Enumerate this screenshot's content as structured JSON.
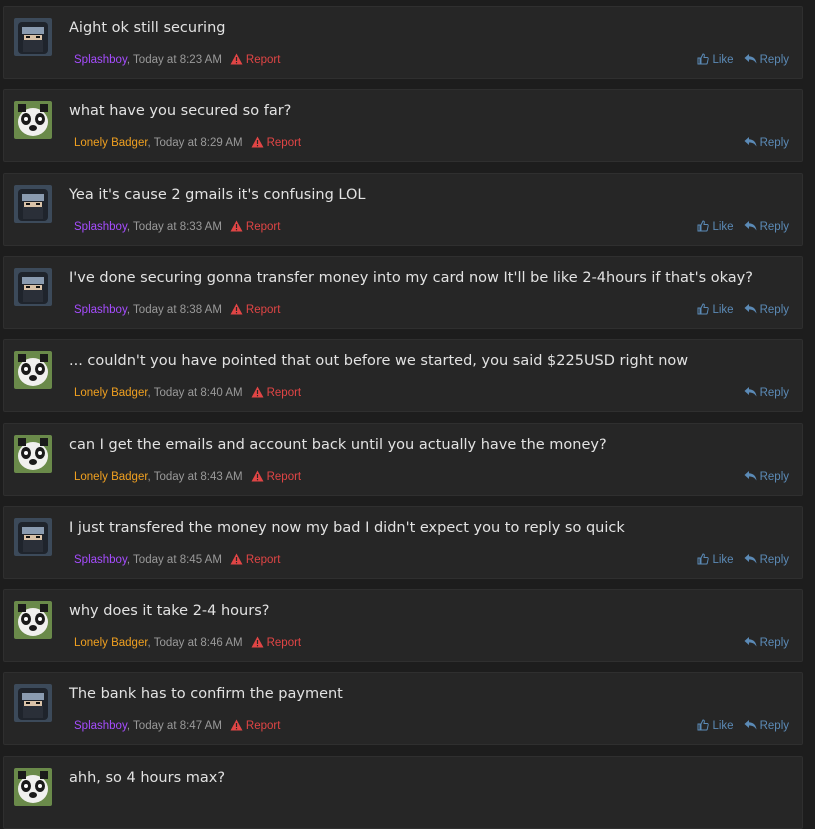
{
  "users": {
    "splashboy": {
      "name": "Splashboy",
      "color": "#a64dff"
    },
    "badger": {
      "name": "Lonely Badger",
      "color": "#f0a020"
    }
  },
  "labels": {
    "like": "Like",
    "reply": "Reply",
    "report": "Report"
  },
  "messages": [
    {
      "user": "splashboy",
      "text": "Aight ok still securing",
      "time": ", Today at 8:23 AM",
      "like": true
    },
    {
      "user": "badger",
      "text": "what have you secured so far?",
      "time": ", Today at 8:29 AM",
      "like": false
    },
    {
      "user": "splashboy",
      "text": "Yea it's cause 2 gmails it's confusing LOL",
      "time": ", Today at 8:33 AM",
      "like": true
    },
    {
      "user": "splashboy",
      "text": "I've done securing gonna transfer money into my card now It'll be like 2-4hours if that's okay?",
      "time": ", Today at 8:38 AM",
      "like": true
    },
    {
      "user": "badger",
      "text": "... couldn't you have pointed that out before we started, you said $225USD right now",
      "time": ", Today at 8:40 AM",
      "like": false
    },
    {
      "user": "badger",
      "text": "can I get the emails and account back until you actually have the money?",
      "time": ", Today at 8:43 AM",
      "like": false
    },
    {
      "user": "splashboy",
      "text": "I just transfered the money now my bad I didn't expect you to reply so quick",
      "time": ", Today at 8:45 AM",
      "like": true
    },
    {
      "user": "badger",
      "text": "why does it take 2-4 hours?",
      "time": ", Today at 8:46 AM",
      "like": false
    },
    {
      "user": "splashboy",
      "text": "The bank has to confirm the payment",
      "time": ", Today at 8:47 AM",
      "like": true
    },
    {
      "user": "badger",
      "text": "ahh, so 4 hours max?",
      "time": "",
      "like": false
    }
  ]
}
